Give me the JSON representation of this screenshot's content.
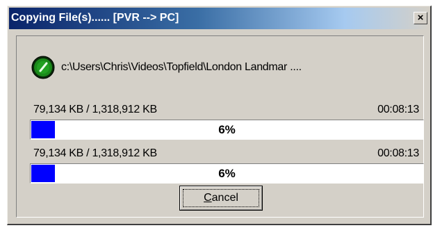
{
  "window": {
    "title": "Copying File(s)...... [PVR --> PC]",
    "close_glyph": "×",
    "close_icon": "close-icon"
  },
  "transfer": {
    "status_icon": "green-disc-icon",
    "file_path": "c:\\Users\\Chris\\Videos\\Topfield\\London Landmar ...."
  },
  "file_progress": {
    "size_text": "79,134 KB / 1,318,912 KB",
    "time_text": "00:08:13",
    "percent_value": 6,
    "percent_text": "6%"
  },
  "total_progress": {
    "size_text": "79,134 KB / 1,318,912 KB",
    "time_text": "00:08:13",
    "percent_value": 6,
    "percent_text": "6%"
  },
  "buttons": {
    "cancel_label": "Cancel"
  },
  "colors": {
    "titlebar_start": "#0a246a",
    "progress_fill": "#0000ff",
    "dialog_face": "#d4d0c8",
    "status_green": "#1a8a1a"
  }
}
